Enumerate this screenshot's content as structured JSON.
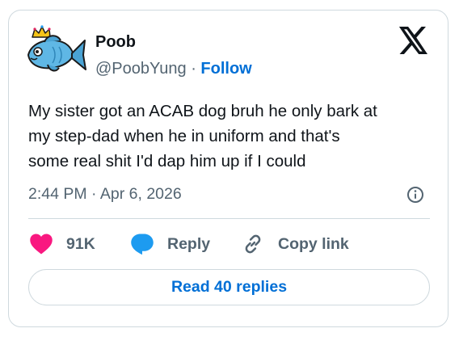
{
  "author": {
    "name": "Poob",
    "handle": "@PoobYung",
    "separator": "·",
    "follow_label": "Follow"
  },
  "tweet": {
    "lines": [
      "My sister got an ACAB dog bruh he only bark at",
      "my step-dad when he in uniform and that's",
      "some real shit I'd dap him up if I could"
    ],
    "timestamp": "2:44 PM · Apr 6, 2026"
  },
  "actions": {
    "likes": "91K",
    "reply_label": "Reply",
    "copy_label": "Copy link"
  },
  "read_replies_label": "Read 40 replies",
  "icons": {
    "avatar": "crowned-blue-fish-avatar",
    "logo": "x-logo-icon",
    "info": "info-icon",
    "like": "heart-icon",
    "reply": "speech-bubble-icon",
    "copy": "link-icon"
  },
  "colors": {
    "link_blue": "#006fd6",
    "like_pink": "#f91880",
    "reply_blue": "#1d9bf0",
    "muted": "#536471",
    "border": "#cfd9de"
  }
}
